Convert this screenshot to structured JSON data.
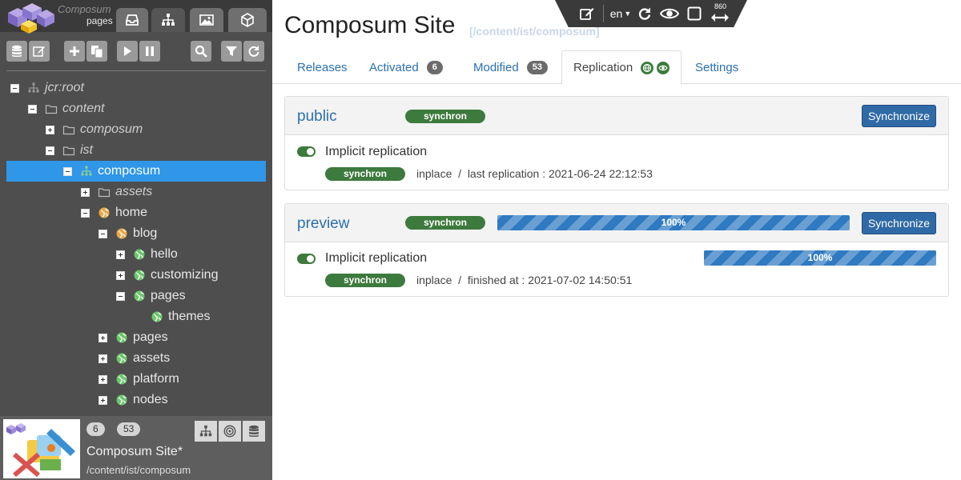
{
  "sidebar": {
    "brand": "Composum",
    "brand_sub": "pages",
    "tabs": [
      "favorites-icon",
      "tree-icon",
      "image-icon",
      "cube-icon"
    ],
    "tree": [
      {
        "label": "jcr:root"
      },
      {
        "label": "content"
      },
      {
        "label": "composum"
      },
      {
        "label": "ist"
      },
      {
        "label": "composum"
      },
      {
        "label": "assets"
      },
      {
        "label": "home"
      },
      {
        "label": "blog"
      },
      {
        "label": "hello"
      },
      {
        "label": "customizing"
      },
      {
        "label": "pages"
      },
      {
        "label": "themes"
      },
      {
        "label": "pages"
      },
      {
        "label": "assets"
      },
      {
        "label": "platform"
      },
      {
        "label": "nodes"
      }
    ],
    "footer": {
      "activated_count": "6",
      "modified_count": "53",
      "title": "Composum Site*",
      "path": "/content/ist/composum"
    }
  },
  "top_toolbar": {
    "language": "en",
    "width": "860"
  },
  "main": {
    "title": "Composum Site",
    "path": "[/content/ist/composum]",
    "tabs": [
      {
        "label": "Releases"
      },
      {
        "label": "Activated",
        "badge": "6"
      },
      {
        "label": "Modified",
        "badge": "53"
      },
      {
        "label": "Replication"
      },
      {
        "label": "Settings"
      }
    ],
    "panels": [
      {
        "name": "public",
        "status": "synchron",
        "button": "Synchronize",
        "implicit_label": "Implicit replication",
        "implicit_status": "synchron",
        "info": "inplace  /  last replication : 2021-06-24 22:12:53"
      },
      {
        "name": "preview",
        "status": "synchron",
        "progress_label": "100%",
        "progress": 1.0,
        "button": "Synchronize",
        "implicit_label": "Implicit replication",
        "implicit_status": "synchron",
        "implicit_progress_label": "100%",
        "implicit_progress": 1.0,
        "info": "inplace  /  finished at : 2021-07-02 14:50:51"
      }
    ]
  },
  "colors": {
    "selected": "#2f96e8",
    "status_green": "#3d7a3d",
    "link_blue": "#2a70b0",
    "button_blue": "#2f6aa6"
  }
}
